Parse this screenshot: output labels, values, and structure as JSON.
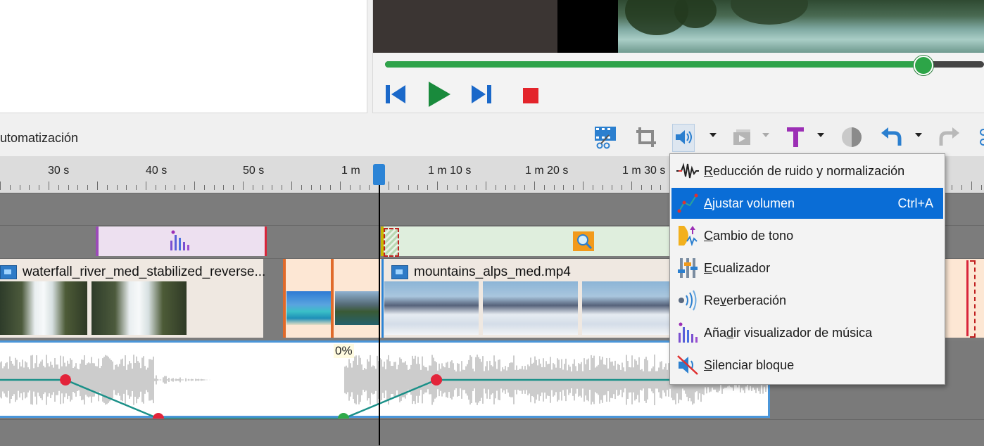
{
  "toolbar": {
    "tab_label": "utomatización",
    "buttons": [
      {
        "name": "cut-video-button",
        "icon": "film-scissors-icon"
      },
      {
        "name": "crop-button",
        "icon": "crop-icon"
      },
      {
        "name": "audio-effects-button",
        "icon": "speaker-icon"
      },
      {
        "name": "video-effects-button",
        "icon": "effects-icon"
      },
      {
        "name": "text-button",
        "icon": "text-T-icon"
      },
      {
        "name": "color-button",
        "icon": "color-circle-icon"
      },
      {
        "name": "undo-button",
        "icon": "undo-icon"
      },
      {
        "name": "redo-button",
        "icon": "redo-icon"
      }
    ]
  },
  "player": {
    "progress": 0.9
  },
  "ruler": {
    "labels": [
      "30 s",
      "40 s",
      "50 s",
      "1 m",
      "1 m 10 s",
      "1 m 20 s",
      "1 m 30 s"
    ]
  },
  "timeline": {
    "clips": {
      "waterfall": "waterfall_river_med_stabilized_reverse...",
      "mountains": "mountains_alps_med.mp4"
    },
    "audio_percent": "0%"
  },
  "audio_menu": {
    "items": [
      {
        "pre": "",
        "u": "R",
        "post": "educción de ruido y normalización",
        "shortcut": "",
        "icon": "noise-wave-icon"
      },
      {
        "pre": "",
        "u": "A",
        "post": "justar volumen",
        "shortcut": "Ctrl+A",
        "icon": "volume-curve-icon",
        "selected": true
      },
      {
        "pre": "",
        "u": "C",
        "post": "ambio de tono",
        "shortcut": "",
        "icon": "pitch-icon"
      },
      {
        "pre": "",
        "u": "E",
        "post": "cualizador",
        "shortcut": "",
        "icon": "equalizer-icon"
      },
      {
        "pre": "Re",
        "u": "v",
        "post": "erberación",
        "shortcut": "",
        "icon": "reverb-icon"
      },
      {
        "pre": "Aña",
        "u": "d",
        "post": "ir visualizador de música",
        "shortcut": "",
        "icon": "music-visualizer-icon"
      },
      {
        "pre": "",
        "u": "S",
        "post": "ilenciar bloque",
        "shortcut": "",
        "icon": "mute-icon"
      }
    ]
  },
  "colors": {
    "accent": "#0a6dd6",
    "progress": "#2fa34a",
    "audio_lane_border": "#4b96d9"
  }
}
